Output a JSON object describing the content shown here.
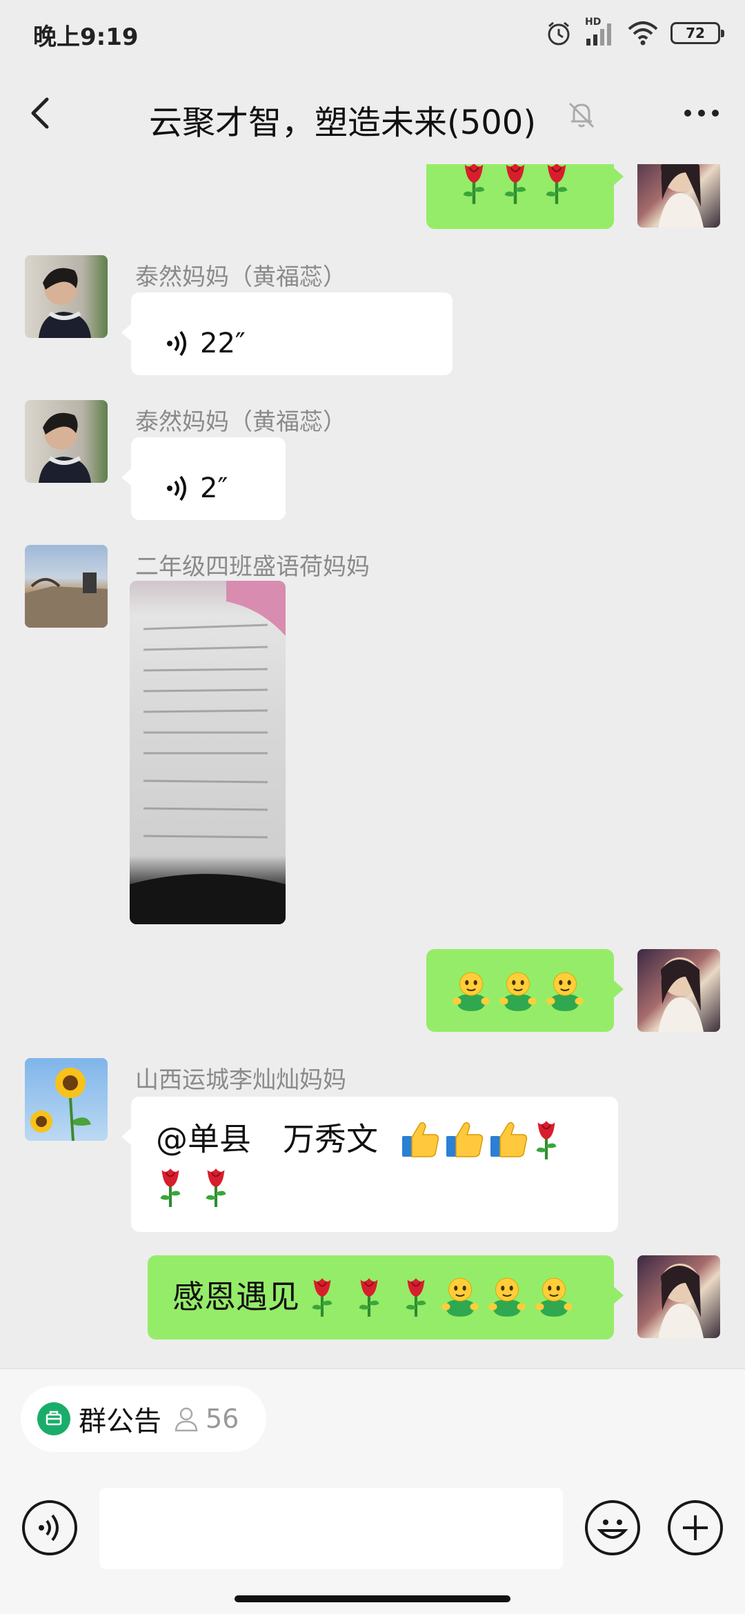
{
  "status_bar": {
    "time": "晚上9:19",
    "network_label": "HD",
    "battery": "72"
  },
  "header": {
    "title": "云聚才智，塑造未来(500)",
    "back_icon": "chevron-left-icon",
    "mute_icon": "bell-off-icon",
    "more_icon": "more-dots-icon"
  },
  "messages": [
    {
      "direction": "out",
      "type": "emoji",
      "emojis": [
        "rose",
        "rose",
        "rose"
      ]
    },
    {
      "direction": "in",
      "type": "voice",
      "sender": "泰然妈妈（黄福蕊）",
      "duration": "22″"
    },
    {
      "direction": "in",
      "type": "voice",
      "sender": "泰然妈妈（黄福蕊）",
      "duration": "2″"
    },
    {
      "direction": "in",
      "type": "image",
      "sender": "二年级四班盛语荷妈妈"
    },
    {
      "direction": "out",
      "type": "emoji",
      "emojis": [
        "hug",
        "hug",
        "hug"
      ]
    },
    {
      "direction": "in",
      "type": "text",
      "sender": "山西运城李灿灿妈妈",
      "text": "@单县　万秀文",
      "emojis": [
        "thumbs-up",
        "thumbs-up",
        "thumbs-up",
        "rose",
        "rose",
        "rose"
      ]
    },
    {
      "direction": "out",
      "type": "text",
      "text": "感恩遇见",
      "emojis": [
        "rose",
        "rose",
        "rose",
        "hug",
        "hug",
        "hug"
      ]
    }
  ],
  "bottom": {
    "notice_label": "群公告",
    "notice_count": "56",
    "input_value": "",
    "voice_icon": "voice-icon",
    "emoji_icon": "smiley-icon",
    "plus_icon": "plus-icon"
  },
  "colors": {
    "background": "#ededed",
    "outgoing_bubble": "#95ec69",
    "incoming_bubble": "#ffffff",
    "sender_name": "#8a8a8a",
    "notice_green": "#1aad6a"
  }
}
